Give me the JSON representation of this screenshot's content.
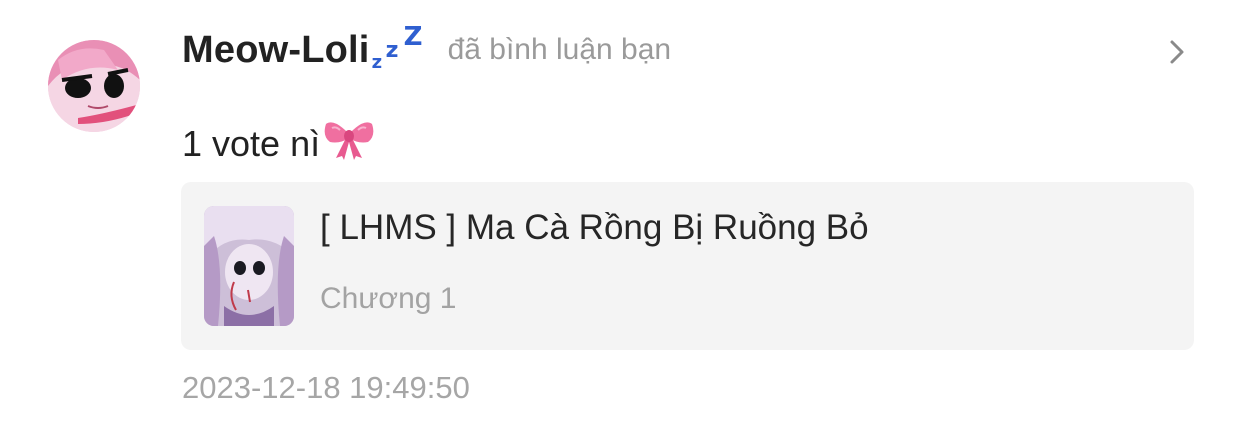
{
  "notification": {
    "avatar_icon": "anime-girl-avatar",
    "username": "Meow-Loli",
    "badge": {
      "z_small": "z",
      "z_medium": "z",
      "z_large": "Z",
      "color": "#2f5fd0"
    },
    "action_text": "đã bình luận bạn",
    "comment_text": "1 vote nì",
    "comment_emoji_icon": "pink-ribbon-bow-icon",
    "story": {
      "title": "[ LHMS ] Ma Cà Rồng Bị Ruồng Bỏ",
      "chapter": "Chương 1",
      "cover_icon": "story-cover-thumbnail"
    },
    "timestamp": "2023-12-18 19:49:50"
  },
  "colors": {
    "username": "#222222",
    "muted": "#9a9a9a",
    "card_background": "#f4f4f4",
    "badge": "#2f5fd0",
    "bow": "#f06fa0"
  }
}
